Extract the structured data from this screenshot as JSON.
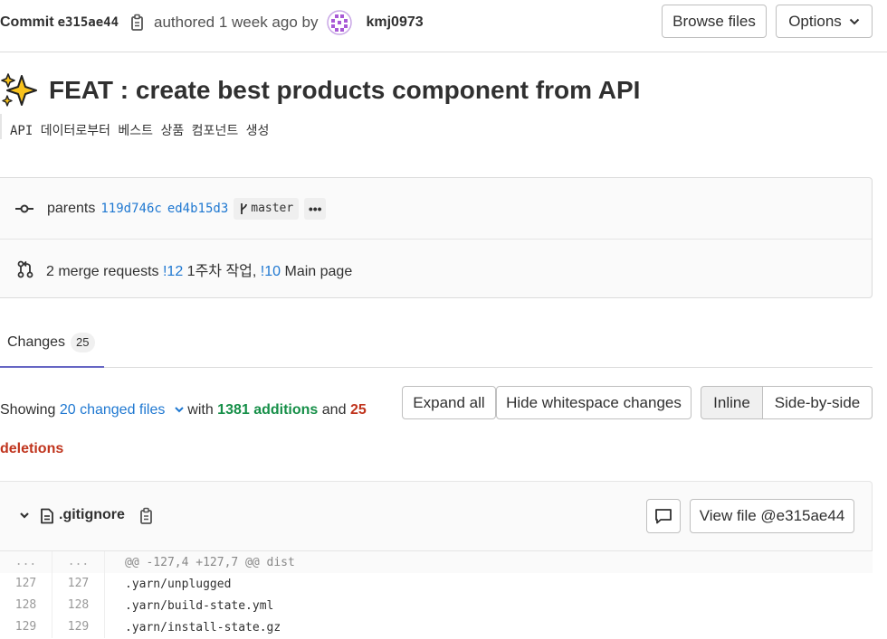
{
  "header": {
    "commit_label": "Commit",
    "sha": "e315ae44",
    "authored_text": "authored 1 week ago by",
    "author": "kmj0973",
    "browse_files_label": "Browse files",
    "options_label": "Options"
  },
  "commit": {
    "title": "FEAT : create best products component from API",
    "description": "API 데이터로부터 베스트 상품 컴포넌트 생성"
  },
  "info": {
    "parents_label": "parents",
    "parent_shas": [
      "119d746c",
      "ed4b15d3"
    ],
    "branch": "master",
    "more_label": "•••",
    "mr_count_text": "2 merge requests",
    "mr1_ref": "!12",
    "mr1_title": "1주차 작업,",
    "mr2_ref": "!10",
    "mr2_title": "Main page"
  },
  "tabs": {
    "changes_label": "Changes",
    "changes_count": "25"
  },
  "summary": {
    "showing": "Showing",
    "files": "20 changed files",
    "with": "with",
    "additions": "1381 additions",
    "and": "and",
    "deletions": "25 deletions",
    "expand_all": "Expand all",
    "hide_whitespace": "Hide whitespace changes",
    "inline": "Inline",
    "side_by_side": "Side-by-side"
  },
  "file": {
    "name": ".gitignore",
    "view_file_label": "View file @e315ae44"
  },
  "diff": {
    "hunk": {
      "old": "...",
      "new": "...",
      "text": "@@ -127,4 +127,7 @@ dist"
    },
    "lines": [
      {
        "old": "127",
        "new": "127",
        "text": ".yarn/unplugged"
      },
      {
        "old": "128",
        "new": "128",
        "text": ".yarn/build-state.yml"
      },
      {
        "old": "129",
        "new": "129",
        "text": ".yarn/install-state.gz"
      }
    ]
  },
  "colors": {
    "link": "#1f78d1",
    "additions": "#168f48",
    "deletions": "#c0341d",
    "tab_active": "#6666c4"
  }
}
